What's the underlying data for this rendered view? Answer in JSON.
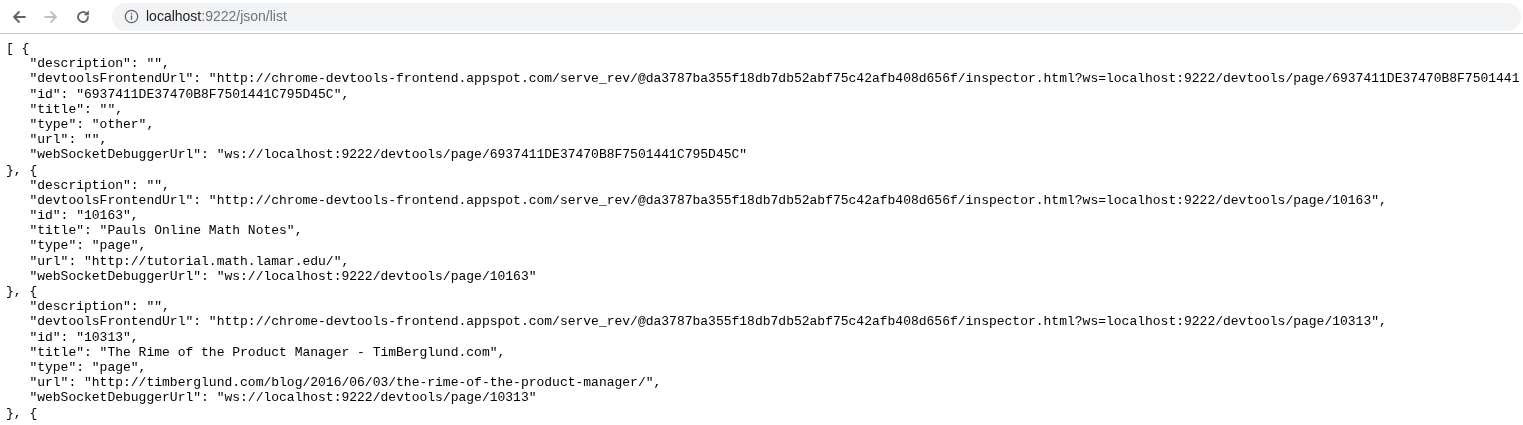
{
  "toolbar": {
    "buttons": [
      {
        "kind": "back",
        "disabled": false
      },
      {
        "kind": "forward",
        "disabled": true
      },
      {
        "kind": "reload",
        "disabled": false
      }
    ],
    "address": {
      "host": "localhost",
      "path": ":9222/json/list"
    }
  },
  "lines": [
    "[ {",
    "   \"description\": \"\",",
    "   \"devtoolsFrontendUrl\": \"http://chrome-devtools-frontend.appspot.com/serve_rev/@da3787ba355f18db7db52abf75c42afb408d656f/inspector.html?ws=localhost:9222/devtools/page/6937411DE37470B8F7501441",
    "   \"id\": \"6937411DE37470B8F7501441C795D45C\",",
    "   \"title\": \"\",",
    "   \"type\": \"other\",",
    "   \"url\": \"\",",
    "   \"webSocketDebuggerUrl\": \"ws://localhost:9222/devtools/page/6937411DE37470B8F7501441C795D45C\"",
    "}, {",
    "   \"description\": \"\",",
    "   \"devtoolsFrontendUrl\": \"http://chrome-devtools-frontend.appspot.com/serve_rev/@da3787ba355f18db7db52abf75c42afb408d656f/inspector.html?ws=localhost:9222/devtools/page/10163\",",
    "   \"id\": \"10163\",",
    "   \"title\": \"Pauls Online Math Notes\",",
    "   \"type\": \"page\",",
    "   \"url\": \"http://tutorial.math.lamar.edu/\",",
    "   \"webSocketDebuggerUrl\": \"ws://localhost:9222/devtools/page/10163\"",
    "}, {",
    "   \"description\": \"\",",
    "   \"devtoolsFrontendUrl\": \"http://chrome-devtools-frontend.appspot.com/serve_rev/@da3787ba355f18db7db52abf75c42afb408d656f/inspector.html?ws=localhost:9222/devtools/page/10313\",",
    "   \"id\": \"10313\",",
    "   \"title\": \"The Rime of the Product Manager - TimBerglund.com\",",
    "   \"type\": \"page\",",
    "   \"url\": \"http://timberglund.com/blog/2016/06/03/the-rime-of-the-product-manager/\",",
    "   \"webSocketDebuggerUrl\": \"ws://localhost:9222/devtools/page/10313\"",
    "}, {"
  ]
}
